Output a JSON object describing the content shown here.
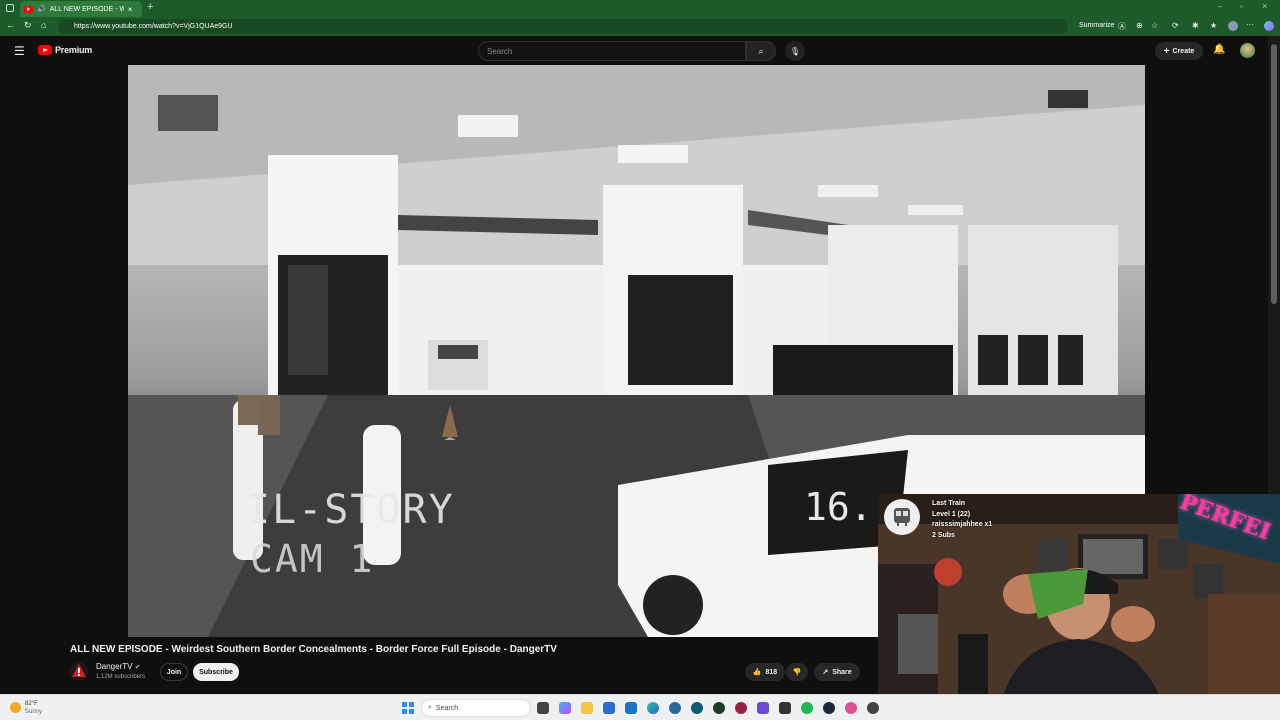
{
  "browser": {
    "tab_title": "ALL NEW EPISODE - Weirdest Southern Border Concealments",
    "url": "https://www.youtube.com/watch?v=VjG1QUAe9GU",
    "summarize_label": "Summarize"
  },
  "youtube": {
    "logo_label": "Premium",
    "search_placeholder": "Search",
    "create_label": "Create"
  },
  "video": {
    "overlay_text_1": "IL-STORY",
    "overlay_text_2": "CAM 1",
    "overlay_text_3": "16."
  },
  "info": {
    "title": "ALL NEW EPISODE - Weirdest Southern Border Concealments - Border Force Full Episode - DangerTV",
    "channel": "DangerTV",
    "subscribers": "1.12M subscribers",
    "join_label": "Join",
    "subscribe_label": "Subscribe",
    "likes": "818",
    "share_label": "Share"
  },
  "stream_overlay": {
    "line1": "Last Train",
    "line2": "Level 1 (22)",
    "line3": "raisssimjahhee x1",
    "line4": "2 Subs",
    "sign_text": "PERFEI"
  },
  "taskbar": {
    "temperature": "82°F",
    "weather": "Sunny",
    "search_label": "Search"
  },
  "colors": {
    "browser_green": "#1e5b2a",
    "youtube_red": "#ff0000",
    "yt_background": "#0f0f0f"
  }
}
